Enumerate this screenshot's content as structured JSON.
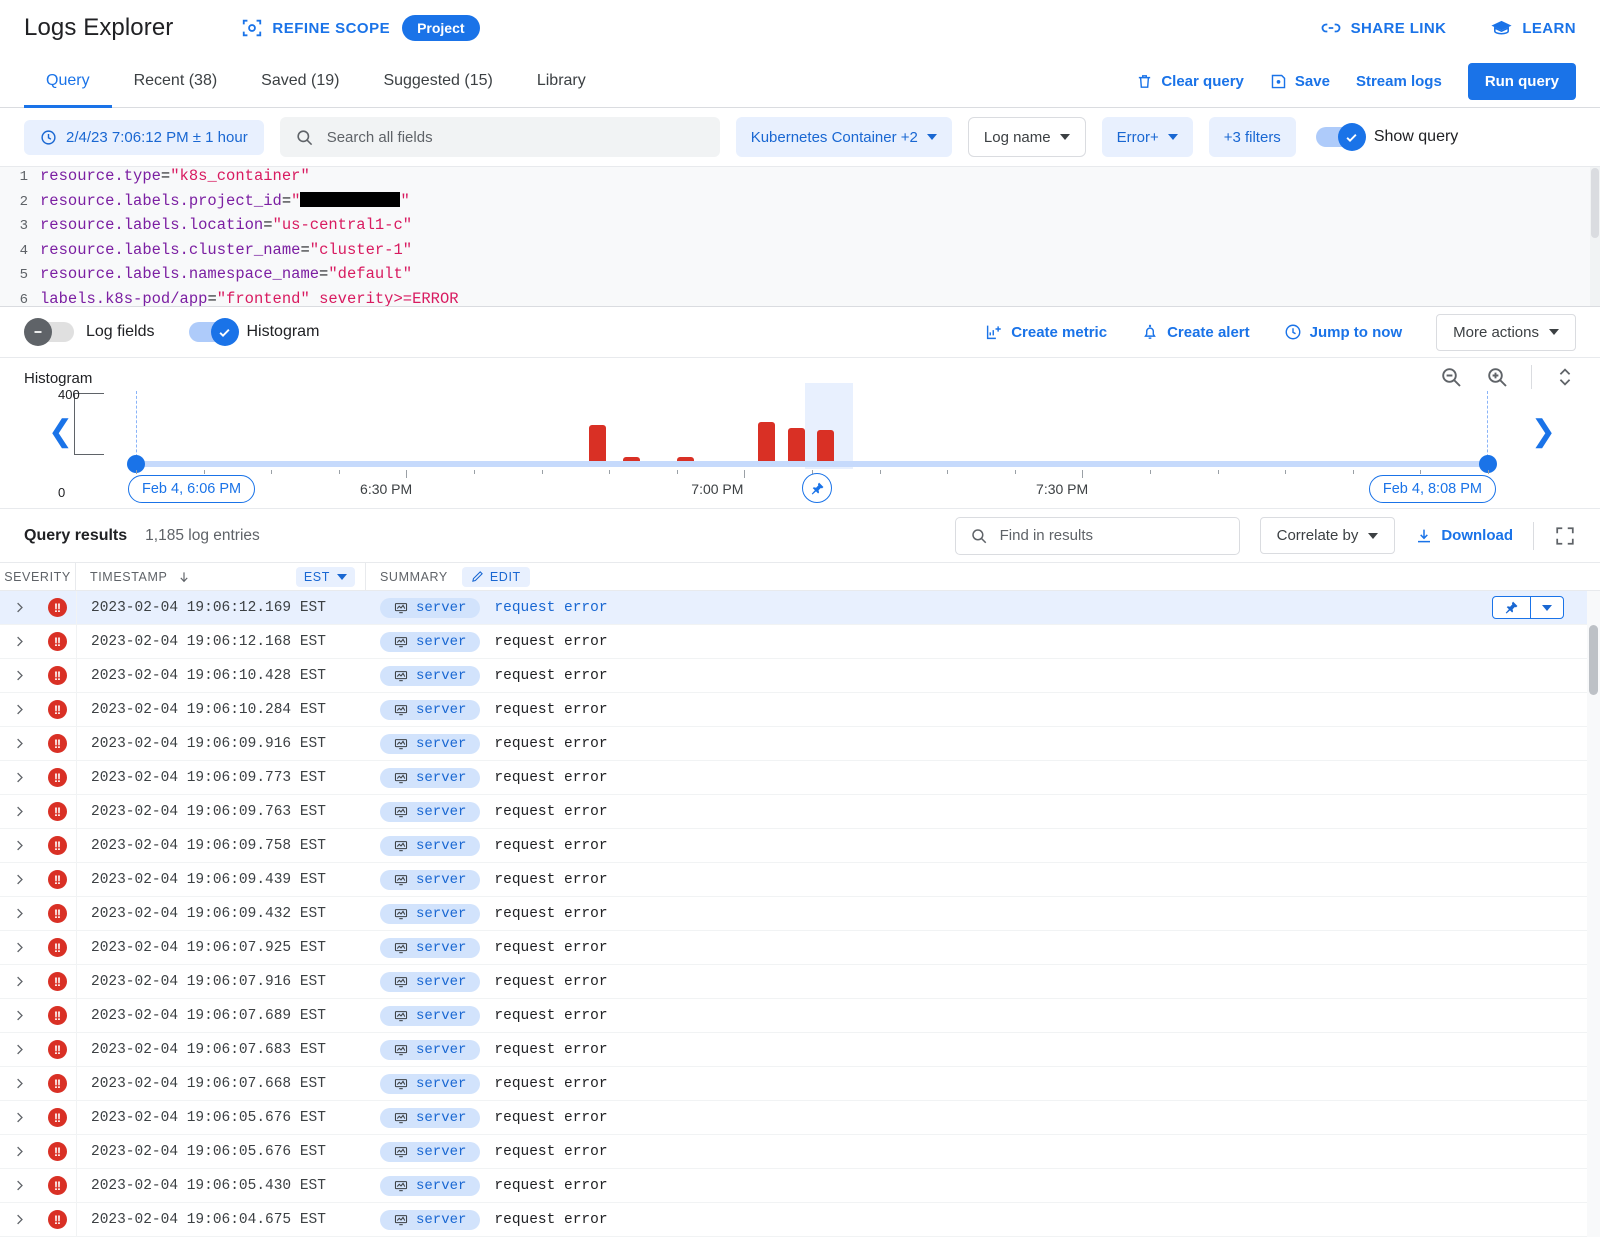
{
  "appbar": {
    "title": "Logs Explorer",
    "refine_scope": "REFINE SCOPE",
    "project_chip": "Project",
    "share_link": "SHARE LINK",
    "learn": "LEARN"
  },
  "tabs": [
    {
      "label": "Query",
      "active": true
    },
    {
      "label": "Recent (38)",
      "active": false
    },
    {
      "label": "Saved (19)",
      "active": false
    },
    {
      "label": "Suggested (15)",
      "active": false
    },
    {
      "label": "Library",
      "active": false
    }
  ],
  "tab_actions": {
    "clear_query": "Clear query",
    "save": "Save",
    "stream_logs": "Stream logs",
    "run_query": "Run query"
  },
  "filters": {
    "time_range": "2/4/23 7:06:12 PM ± 1 hour",
    "search_placeholder": "Search all fields",
    "search_value": "",
    "resource": "Kubernetes Container +2",
    "log_name": "Log name",
    "severity": "Error+",
    "more_filters": "+3 filters",
    "show_query_label": "Show query",
    "show_query_on": true
  },
  "query_editor": {
    "lines": [
      {
        "num": "1",
        "field": "resource.type",
        "op": "=",
        "value": "\"k8s_container\"",
        "redacted": false
      },
      {
        "num": "2",
        "field": "resource.labels.project_id",
        "op": "=",
        "value": "\"",
        "redacted": true,
        "value_end": "\""
      },
      {
        "num": "3",
        "field": "resource.labels.location",
        "op": "=",
        "value": "\"us-central1-c\"",
        "redacted": false
      },
      {
        "num": "4",
        "field": "resource.labels.cluster_name",
        "op": "=",
        "value": "\"cluster-1\"",
        "redacted": false
      },
      {
        "num": "5",
        "field": "resource.labels.namespace_name",
        "op": "=",
        "value": "\"default\"",
        "redacted": false
      },
      {
        "num": "6",
        "field": "labels.k8s-pod/app",
        "op": "=",
        "value": "\"frontend\" severity>=ERROR",
        "redacted": false
      }
    ]
  },
  "hist_toolbar": {
    "log_fields_label": "Log fields",
    "log_fields_on": false,
    "histogram_label": "Histogram",
    "histogram_on": true,
    "create_metric": "Create metric",
    "create_alert": "Create alert",
    "jump_to_now": "Jump to now",
    "more_actions": "More actions"
  },
  "chart_data": {
    "type": "bar",
    "title": "Histogram",
    "xlabel": "",
    "ylabel": "",
    "ylim": [
      0,
      400
    ],
    "ytick_labels": [
      "400",
      "0"
    ],
    "axis_start_label": "Feb 4, 6:06 PM",
    "axis_end_label": "Feb 4, 8:08 PM",
    "xtick_labels": [
      "6:30 PM",
      "7:00 PM",
      "7:30 PM"
    ],
    "xtick_positions_pct": [
      18.5,
      43.0,
      68.5
    ],
    "bar_color": "#d93025",
    "grid": false,
    "legend": null,
    "highlight_band_pct": [
      49.5,
      53.0
    ],
    "bars": [
      {
        "x_pct": 33.5,
        "value": 230
      },
      {
        "x_pct": 36.0,
        "value": 14
      },
      {
        "x_pct": 40.0,
        "value": 14
      },
      {
        "x_pct": 46.0,
        "value": 250
      },
      {
        "x_pct": 48.2,
        "value": 215
      },
      {
        "x_pct": 50.4,
        "value": 200
      }
    ]
  },
  "results_bar": {
    "title": "Query results",
    "count": "1,185 log entries",
    "find_placeholder": "Find in results",
    "find_value": "",
    "correlate_by": "Correlate by",
    "download": "Download"
  },
  "table": {
    "headers": {
      "severity": "SEVERITY",
      "timestamp": "TIMESTAMP",
      "timezone": "EST",
      "summary": "SUMMARY",
      "edit": "EDIT"
    },
    "rows": [
      {
        "timestamp": "2023-02-04 19:06:12.169 EST",
        "service": "server",
        "summary": "request error",
        "selected": true
      },
      {
        "timestamp": "2023-02-04 19:06:12.168 EST",
        "service": "server",
        "summary": "request error",
        "selected": false
      },
      {
        "timestamp": "2023-02-04 19:06:10.428 EST",
        "service": "server",
        "summary": "request error",
        "selected": false
      },
      {
        "timestamp": "2023-02-04 19:06:10.284 EST",
        "service": "server",
        "summary": "request error",
        "selected": false
      },
      {
        "timestamp": "2023-02-04 19:06:09.916 EST",
        "service": "server",
        "summary": "request error",
        "selected": false
      },
      {
        "timestamp": "2023-02-04 19:06:09.773 EST",
        "service": "server",
        "summary": "request error",
        "selected": false
      },
      {
        "timestamp": "2023-02-04 19:06:09.763 EST",
        "service": "server",
        "summary": "request error",
        "selected": false
      },
      {
        "timestamp": "2023-02-04 19:06:09.758 EST",
        "service": "server",
        "summary": "request error",
        "selected": false
      },
      {
        "timestamp": "2023-02-04 19:06:09.439 EST",
        "service": "server",
        "summary": "request error",
        "selected": false
      },
      {
        "timestamp": "2023-02-04 19:06:09.432 EST",
        "service": "server",
        "summary": "request error",
        "selected": false
      },
      {
        "timestamp": "2023-02-04 19:06:07.925 EST",
        "service": "server",
        "summary": "request error",
        "selected": false
      },
      {
        "timestamp": "2023-02-04 19:06:07.916 EST",
        "service": "server",
        "summary": "request error",
        "selected": false
      },
      {
        "timestamp": "2023-02-04 19:06:07.689 EST",
        "service": "server",
        "summary": "request error",
        "selected": false
      },
      {
        "timestamp": "2023-02-04 19:06:07.683 EST",
        "service": "server",
        "summary": "request error",
        "selected": false
      },
      {
        "timestamp": "2023-02-04 19:06:07.668 EST",
        "service": "server",
        "summary": "request error",
        "selected": false
      },
      {
        "timestamp": "2023-02-04 19:06:05.676 EST",
        "service": "server",
        "summary": "request error",
        "selected": false
      },
      {
        "timestamp": "2023-02-04 19:06:05.676 EST",
        "service": "server",
        "summary": "request error",
        "selected": false
      },
      {
        "timestamp": "2023-02-04 19:06:05.430 EST",
        "service": "server",
        "summary": "request error",
        "selected": false
      },
      {
        "timestamp": "2023-02-04 19:06:04.675 EST",
        "service": "server",
        "summary": "request error",
        "selected": false
      }
    ]
  }
}
